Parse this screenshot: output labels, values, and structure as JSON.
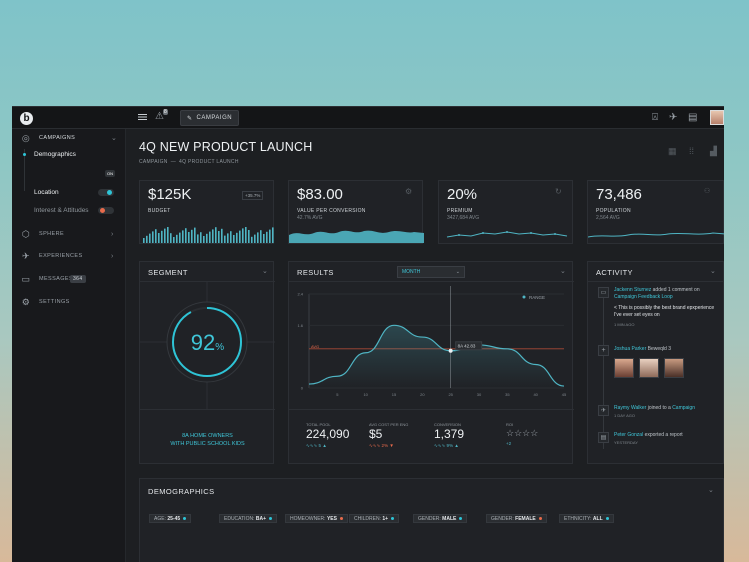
{
  "topbar": {
    "logo": "b",
    "campaign_label": "CAMPAIGN",
    "notif_count": "8"
  },
  "sidebar": {
    "campaigns": "CAMPAIGNS",
    "sub": [
      {
        "label": "Demographics",
        "state": "ON"
      },
      {
        "label": "Location"
      },
      {
        "label": "Interest & Attitudes"
      }
    ],
    "items": [
      {
        "label": "SPHERE"
      },
      {
        "label": "EXPERIENCES"
      },
      {
        "label": "MESSAGES",
        "badge": "364"
      },
      {
        "label": "SETTINGS"
      }
    ]
  },
  "page": {
    "title": "4Q NEW PRODUCT LAUNCH",
    "breadcrumb_a": "CAMPAIGN",
    "breadcrumb_sep": "—",
    "breadcrumb_b": "4Q PRODUCT LAUNCH"
  },
  "kpis": [
    {
      "value": "$125K",
      "label": "BUDGET",
      "sub": "",
      "badge": "+35.7%"
    },
    {
      "value": "$83.00",
      "label": "VALUE PER CONVERSION",
      "sub": "42.7% AVG"
    },
    {
      "value": "20%",
      "label": "PREMIUM",
      "sub": "3427,684 AVG"
    },
    {
      "value": "73,486",
      "label": "POPULATION",
      "sub": "2,564 AVG"
    }
  ],
  "segment": {
    "title": "SEGMENT",
    "percent": "92",
    "unit": "%",
    "level": 0.92,
    "line1": "8A HOME OWNERS",
    "line2": "WITH PUBLIC SCHOOL KIDS"
  },
  "results": {
    "title": "RESULTS",
    "dropdown": "MONTH",
    "legend": "RANGE",
    "tooltip": "8A 42.83",
    "stats": [
      {
        "label": "TOTAL POOL",
        "value": "224,090",
        "delta": "5"
      },
      {
        "label": "AVG COST PER ENG",
        "value": "$5",
        "delta": "2%"
      },
      {
        "label": "CONVERSION",
        "value": "1,379",
        "delta": "9%"
      },
      {
        "label": "ROI",
        "value": "",
        "delta": "+2",
        "stars": 2
      }
    ]
  },
  "chart_data": {
    "type": "area",
    "x": [
      0,
      5,
      10,
      15,
      20,
      25,
      30,
      35,
      40,
      45
    ],
    "series": [
      {
        "values": [
          0.1,
          0.3,
          0.9,
          1.6,
          1.3,
          0.95,
          1.1,
          1.0,
          0.6,
          0.05
        ]
      }
    ],
    "ylim": [
      0,
      2.4
    ],
    "yticks": [
      "0",
      "1.6",
      "2.4"
    ],
    "xticks": [
      "5",
      "10",
      "15",
      "20",
      "25",
      "30",
      "35",
      "40",
      "45"
    ],
    "avg_label": "AVG"
  },
  "activity": {
    "title": "ACTIVITY",
    "items": [
      {
        "name": "Jackenn Sturnez",
        "text": "added 1 comment on",
        "link": "Campaign Feedback Loop",
        "quote": "< This is possibly the best brand epxperience I've ever set eyes on",
        "time": "1 MIN AGO"
      },
      {
        "name": "Joshua Parker",
        "text": "Beweqld 3",
        "time": ""
      },
      {
        "name": "Raymy Walker",
        "text": "joined to a",
        "link": "Campaign",
        "time": "1 DAY AGO"
      },
      {
        "name": "Peter Gonzal",
        "text": "exported a report",
        "time": "YESTERDAY"
      }
    ]
  },
  "demographics": {
    "title": "DEMOGRAPHICS",
    "pills": [
      {
        "k": "AGE:",
        "v": "25-45",
        "c": "#2ec4d6"
      },
      {
        "k": "EDUCATION:",
        "v": "BA+",
        "c": "#2ec4d6"
      },
      {
        "k": "HOMEOWNER:",
        "v": "YES",
        "c": "#e86b4c"
      },
      {
        "k": "CHILDREN:",
        "v": "1+",
        "c": "#2ec4d6"
      },
      {
        "k": "GENDER:",
        "v": "MALE",
        "c": "#2ec4d6"
      },
      {
        "k": "GENDER:",
        "v": "FEMALE",
        "c": "#e86b4c"
      },
      {
        "k": "ETHNICITY:",
        "v": "ALL",
        "c": "#2ec4d6"
      }
    ]
  }
}
